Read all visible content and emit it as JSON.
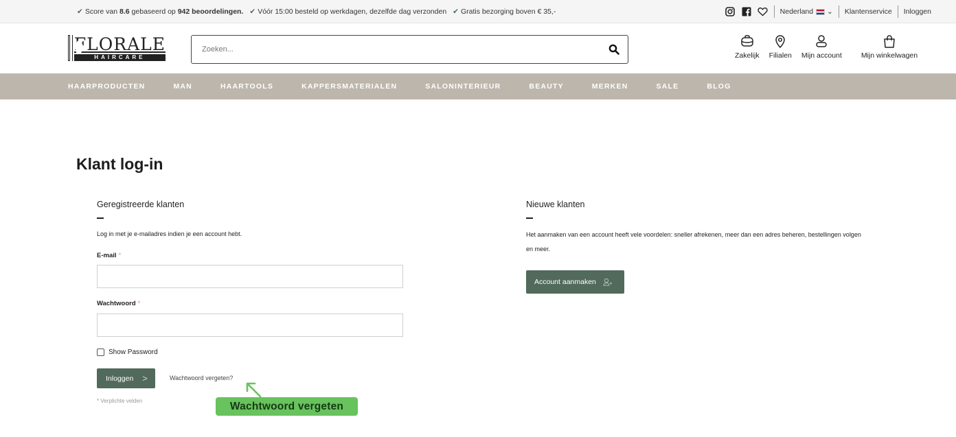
{
  "topbar": {
    "score_prefix": "Score van",
    "score_value": "8.6",
    "score_mid": "gebaseerd op",
    "review_count": "942 beoordelingen.",
    "usp2": "Vóór 15:00 besteld op werkdagen, dezelfde dag verzonden",
    "usp3": "Gratis bezorging boven € 35,-",
    "country": "Nederland",
    "customer_service": "Klantenservice",
    "login": "Inloggen"
  },
  "header": {
    "logo_brand": "FLORALE",
    "logo_sub": "HAIRCARE",
    "search_placeholder": "Zoeken...",
    "icons": {
      "business": "Zakelijk",
      "stores": "Filialen",
      "account": "Mijn account",
      "cart": "Mijn winkelwagen"
    }
  },
  "nav": [
    "HAARPRODUCTEN",
    "MAN",
    "HAARTOOLS",
    "KAPPERSMATERIALEN",
    "SALONINTERIEUR",
    "BEAUTY",
    "MERKEN",
    "SALE",
    "BLOG"
  ],
  "page": {
    "title": "Klant log-in"
  },
  "registered": {
    "title": "Geregistreerde klanten",
    "intro": "Log in met je e-mailadres indien je een account hebt.",
    "email_label": "E-mail",
    "password_label": "Wachtwoord",
    "required_mark": "*",
    "show_password": "Show Password",
    "login_button": "Inloggen",
    "forgot_link": "Wachtwoord vergeten?",
    "required_note": "* Verplichte velden"
  },
  "new_customers": {
    "title": "Nieuwe klanten",
    "text_line1": "Het aanmaken van een account heeft vele voordelen: sneller afrekenen, meer dan een adres beheren, bestellingen volgen",
    "text_line2": "en meer.",
    "create_button": "Account aanmaken"
  },
  "annotation": {
    "label": "Wachtwoord vergeten"
  },
  "colors": {
    "nav_bg": "#bdb6ac",
    "button_green": "#516a5b",
    "annotation_green": "#68c25d"
  }
}
